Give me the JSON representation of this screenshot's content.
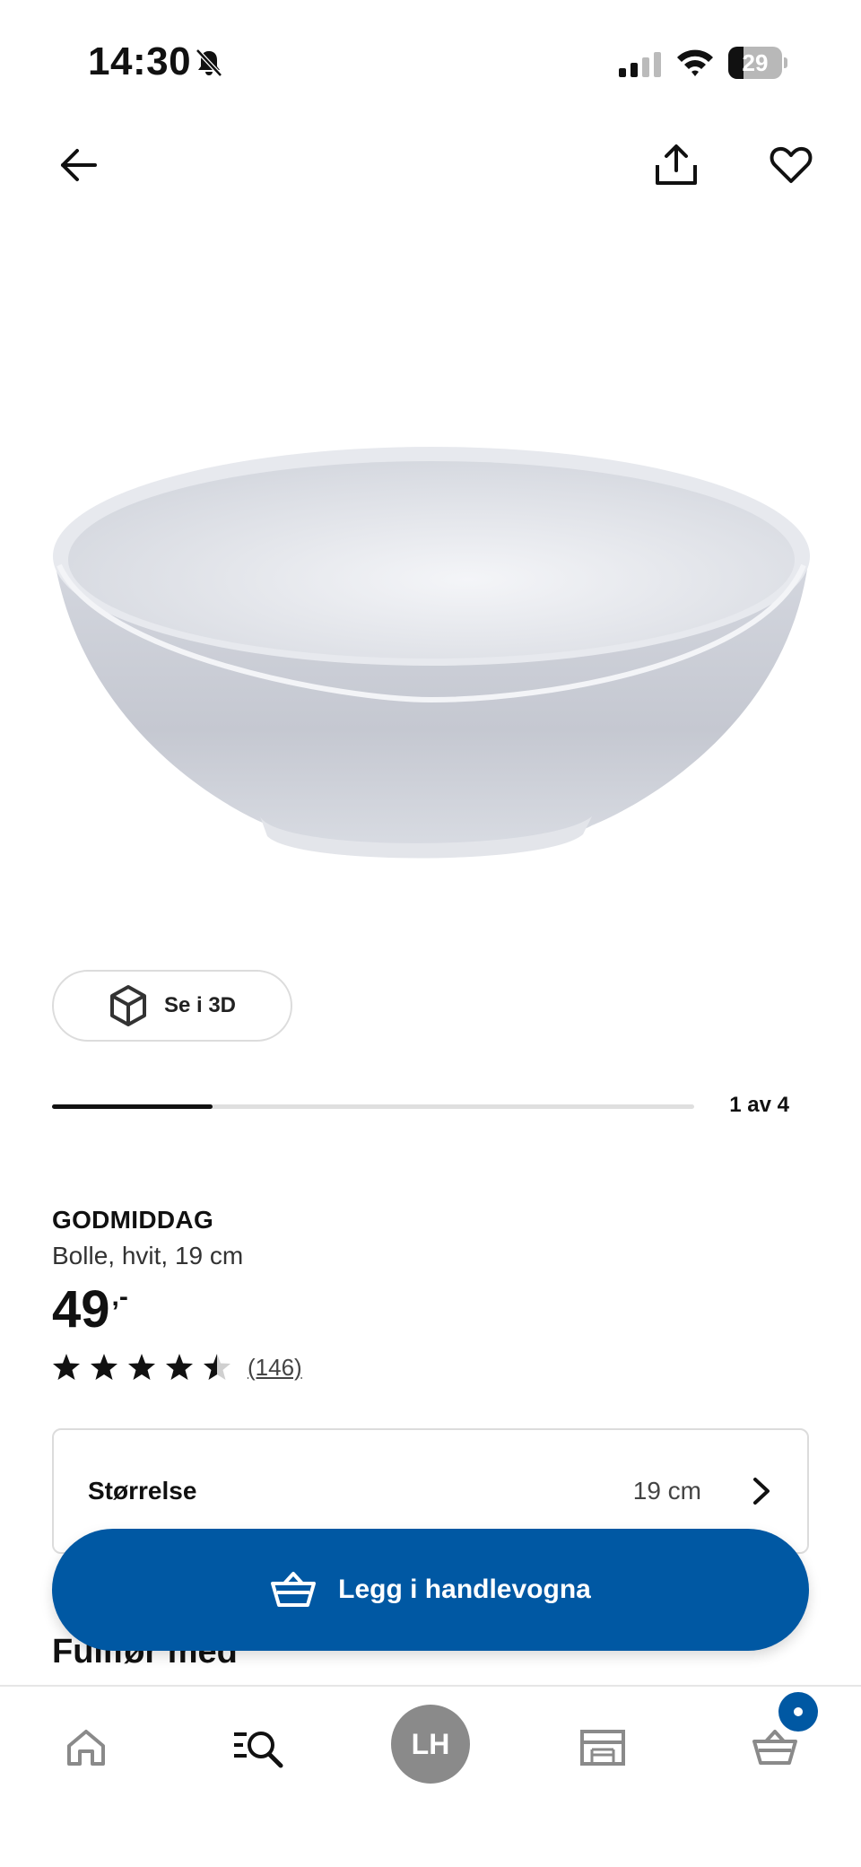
{
  "status_bar": {
    "time": "14:30",
    "battery_level": "29",
    "icons": [
      "mute-icon",
      "signal-icon",
      "wifi-icon",
      "battery-icon"
    ]
  },
  "top_nav": {
    "icons": [
      "arrow-left-icon",
      "share-icon",
      "heart-icon"
    ]
  },
  "view_3d": {
    "label": "Se i 3D",
    "icon": "cube-icon"
  },
  "carousel": {
    "counter": "1 av 4",
    "current": 1,
    "total": 4
  },
  "product": {
    "name": "GODMIDDAG",
    "description": "Bolle, hvit, 19 cm",
    "price": "49",
    "price_suffix": ",-",
    "rating": 4.5,
    "rating_max": 5,
    "review_count": "(146)"
  },
  "size_selector": {
    "label": "Størrelse",
    "value": "19 cm",
    "icon": "chevron-right-icon"
  },
  "section": {
    "title": "Fullfør med"
  },
  "add_to_cart": {
    "label": "Legg i handlevogna",
    "icon": "basket-icon",
    "color": "#0058a3"
  },
  "tab_bar": {
    "tabs": [
      {
        "name": "home",
        "icon": "home-icon"
      },
      {
        "name": "search",
        "icon": "search-icon"
      },
      {
        "name": "profile",
        "initials": "LH"
      },
      {
        "name": "stores",
        "icon": "store-icon"
      },
      {
        "name": "cart",
        "icon": "basket-icon",
        "badge": true
      }
    ],
    "profile_initials": "LH",
    "badge_color": "#0058a3"
  }
}
